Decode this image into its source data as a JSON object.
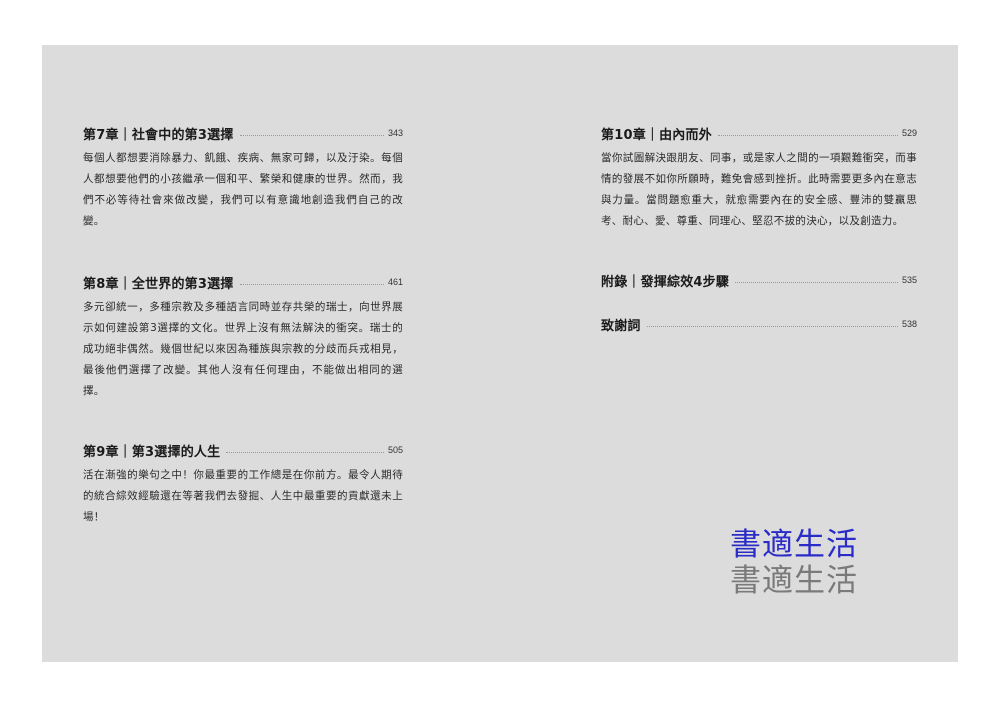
{
  "left_column": [
    {
      "title": "第7章｜社會中的第3選擇",
      "page": "343",
      "summary": "每個人都想要消除暴力、飢餓、疾病、無家可歸，以及汙染。每個人都想要他們的小孩繼承一個和平、繁榮和健康的世界。然而，我們不必等待社會來做改變，我們可以有意識地創造我們自己的改變。"
    },
    {
      "title": "第8章｜全世界的第3選擇",
      "page": "461",
      "summary": "多元卻統一，多種宗教及多種語言同時並存共榮的瑞士，向世界展示如何建設第3選擇的文化。世界上沒有無法解決的衝突。瑞士的成功絕非偶然。幾個世紀以來因為種族與宗教的分歧而兵戎相見，最後他們選擇了改變。其他人沒有任何理由，不能做出相同的選擇。"
    },
    {
      "title": "第9章｜第3選擇的人生",
      "page": "505",
      "summary": "活在漸強的樂句之中！你最重要的工作總是在你前方。最令人期待的統合綜效經驗還在等著我們去發掘、人生中最重要的貢獻還未上場！"
    }
  ],
  "right_column": [
    {
      "title": "第10章｜由內而外",
      "page": "529",
      "summary": "當你試圖解決跟朋友、同事，或是家人之間的一項艱難衝突，而事情的發展不如你所願時，難免會感到挫折。此時需要更多內在意志與力量。當問題愈重大，就愈需要內在的安全感、豐沛的雙贏思考、耐心、愛、尊重、同理心、堅忍不拔的決心，以及創造力。"
    },
    {
      "title": "附錄｜發揮綜效4步驟",
      "page": "535"
    },
    {
      "title": "致謝詞",
      "page": "538"
    }
  ],
  "logo": {
    "text_blue": "書適生活",
    "text_gray": "書適生活",
    "color_blue": "#2b2bc8",
    "color_gray": "#7a7a7a"
  }
}
